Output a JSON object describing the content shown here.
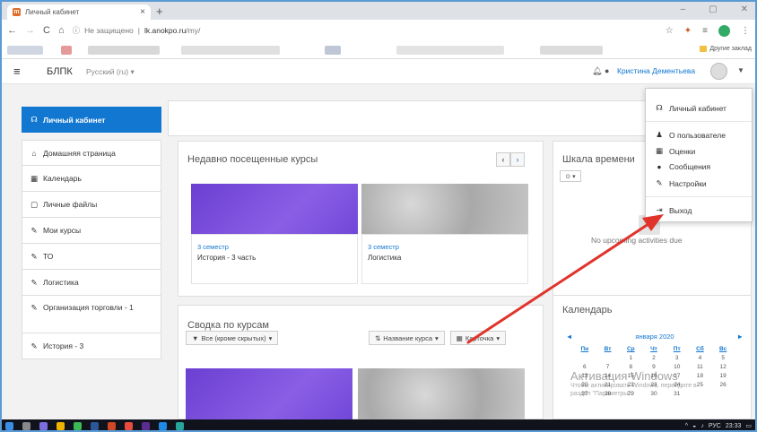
{
  "browser": {
    "tab_title": "Личный кабинет",
    "tab_close": "×",
    "new_tab": "+",
    "window_controls": [
      "–",
      "▢",
      "✕"
    ],
    "nav": {
      "back": "←",
      "forward": "→",
      "reload": "C",
      "home": "⌂"
    },
    "security_label": "Не защищено",
    "url_domain": "lk.anokpo.ru",
    "url_path": "/my/",
    "other_bookmarks": "Другие заклад"
  },
  "navbar": {
    "brand": "БЛПК",
    "language": "Русский (ru)",
    "user_name": "Кристина Дементьева"
  },
  "sidebar": {
    "items": [
      {
        "icon": "☊",
        "label": "Личный кабинет"
      },
      {
        "icon": "⌂",
        "label": "Домашняя страница"
      },
      {
        "icon": "▦",
        "label": "Календарь"
      },
      {
        "icon": "▢",
        "label": "Личные файлы"
      },
      {
        "icon": "✎",
        "label": "Мои курсы"
      },
      {
        "icon": "✎",
        "label": "ТО"
      },
      {
        "icon": "✎",
        "label": "Логистика"
      },
      {
        "icon": "✎",
        "label": "Организация торговли - 1"
      },
      {
        "icon": "✎",
        "label": "История - 3"
      }
    ]
  },
  "recent": {
    "title": "Недавно посещенные курсы",
    "prev": "‹",
    "next": "›",
    "courses": [
      {
        "semester": "3 семестр",
        "name": "История - 3 часть",
        "color": "#7d4ed8"
      },
      {
        "semester": "3 семестр",
        "name": "Логистика",
        "color": "#b0b0b0"
      }
    ]
  },
  "overview": {
    "title": "Сводка по курсам",
    "filter": "Все (кроме скрытых)",
    "sort": "Название курса",
    "view": "Карточка"
  },
  "timeline": {
    "title": "Шкала времени",
    "select": "⊙ ▾",
    "empty": "No upcoming activities due"
  },
  "calendar": {
    "title": "Календарь",
    "month": "января 2020",
    "prev": "◄",
    "next": "►",
    "days": [
      "Пн",
      "Вт",
      "Ср",
      "Чт",
      "Пт",
      "Сб",
      "Вс"
    ],
    "rows": [
      [
        "",
        "",
        "1",
        "2",
        "3",
        "4",
        "5"
      ],
      [
        "6",
        "7",
        "8",
        "9",
        "10",
        "11",
        "12"
      ],
      [
        "13",
        "14",
        "15",
        "16",
        "17",
        "18",
        "19"
      ],
      [
        "20",
        "21",
        "22",
        "23",
        "24",
        "25",
        "26"
      ],
      [
        "27",
        "28",
        "29",
        "30",
        "31",
        "",
        ""
      ]
    ]
  },
  "user_menu": {
    "items": [
      {
        "icon": "☊",
        "label": "Личный кабинет"
      },
      {
        "icon": "♟",
        "label": "О пользователе"
      },
      {
        "icon": "▦",
        "label": "Оценки"
      },
      {
        "icon": "●",
        "label": "Сообщения"
      },
      {
        "icon": "✎",
        "label": "Настройки"
      },
      {
        "icon": "⇥",
        "label": "Выход"
      }
    ]
  },
  "watermark": {
    "line1": "Активация Windows",
    "line2": "Чтобы активировать Windows, перейдите в",
    "line3": "раздел \"Параметры\"."
  },
  "taskbar": {
    "lang": "РУС",
    "time": "23:33"
  },
  "colors": {
    "accent": "#1177d1",
    "annotation_arrow": "#e0332b",
    "course_purple": "#7d4ed8"
  }
}
